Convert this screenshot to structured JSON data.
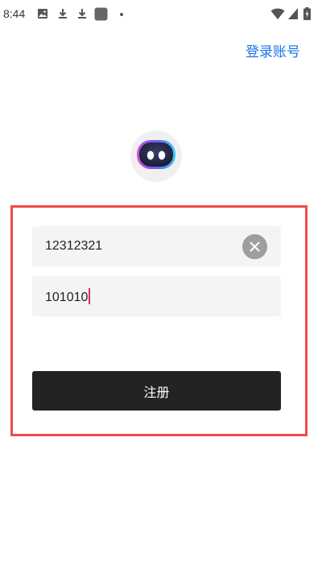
{
  "status_bar": {
    "time": "8:44",
    "notification_icons": [
      "image-icon",
      "download-icon",
      "download-icon",
      "app-square-icon"
    ],
    "system_icons": [
      "wifi-icon",
      "signal-icon",
      "battery-icon"
    ]
  },
  "header": {
    "login_link": "登录账号"
  },
  "form": {
    "account_value": "12312321",
    "password_value": "101010",
    "submit_label": "注册"
  },
  "colors": {
    "link": "#1a73e8",
    "button_bg": "#232323",
    "highlight_frame": "#ef4a4a",
    "caret": "#e0266e"
  }
}
